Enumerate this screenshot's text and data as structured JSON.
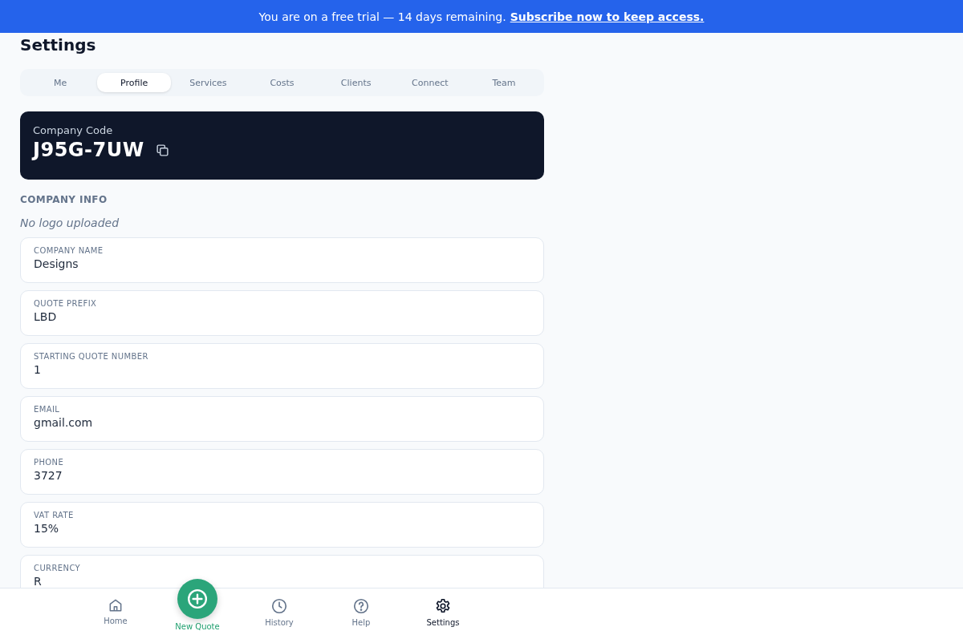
{
  "banner": {
    "text": "You are on a free trial — 14 days remaining.",
    "link": "Subscribe now to keep access."
  },
  "title": "Settings",
  "tabs": [
    {
      "label": "Me",
      "selected": false
    },
    {
      "label": "Profile",
      "selected": true
    },
    {
      "label": "Services",
      "selected": false
    },
    {
      "label": "Costs",
      "selected": false
    },
    {
      "label": "Clients",
      "selected": false
    },
    {
      "label": "Connect",
      "selected": false
    },
    {
      "label": "Team",
      "selected": false
    }
  ],
  "company_code": {
    "label": "Company Code",
    "value": "J95G-7UW"
  },
  "section_title": "COMPANY INFO",
  "logo_note": "No logo uploaded",
  "fields": [
    {
      "label": "COMPANY NAME",
      "value": "Designs"
    },
    {
      "label": "QUOTE PREFIX",
      "value": "LBD"
    },
    {
      "label": "STARTING QUOTE NUMBER",
      "value": "1"
    },
    {
      "label": "EMAIL",
      "value": "gmail.com"
    },
    {
      "label": "PHONE",
      "value": "3727"
    },
    {
      "label": "VAT RATE",
      "value": "15%"
    },
    {
      "label": "CURRENCY",
      "value": "R"
    }
  ],
  "nav": [
    {
      "kind": "home",
      "label": "Home",
      "selected": false
    },
    {
      "kind": "new",
      "label": "New Quote",
      "selected": false
    },
    {
      "kind": "history",
      "label": "History",
      "selected": false
    },
    {
      "kind": "help",
      "label": "Help",
      "selected": false
    },
    {
      "kind": "settings",
      "label": "Settings",
      "selected": true
    }
  ]
}
